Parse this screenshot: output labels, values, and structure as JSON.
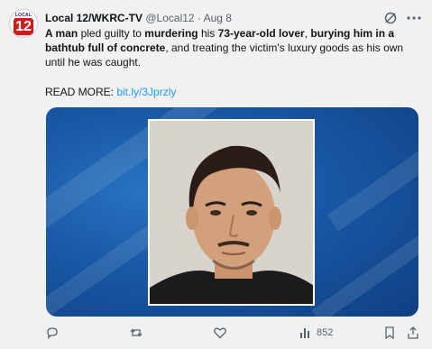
{
  "account": {
    "avatar_text": "LOCAL",
    "avatar_number": "12",
    "name": "Local 12/WKRC-TV",
    "handle": "@Local12",
    "separator": "·",
    "date": "Aug 8"
  },
  "tweet": {
    "segments": [
      {
        "text": "A man",
        "bold": true
      },
      {
        "text": " pled guilty to ",
        "bold": false
      },
      {
        "text": "murdering",
        "bold": true
      },
      {
        "text": " his ",
        "bold": false
      },
      {
        "text": "73-year-old lover",
        "bold": true
      },
      {
        "text": ", ",
        "bold": false
      },
      {
        "text": "burying him in a bathtub full of concrete",
        "bold": true
      },
      {
        "text": ", and treating the victim's luxury goods as his own until he was caught.",
        "bold": false
      }
    ],
    "read_more_label": "READ MORE: ",
    "read_more_link": "bit.ly/3Jprzly"
  },
  "actions": {
    "views_count": "852"
  },
  "icons": {
    "grok": "grok-icon",
    "more": "more-icon",
    "reply": "reply-icon",
    "retweet": "retweet-icon",
    "like": "like-icon",
    "views": "views-icon",
    "bookmark": "bookmark-icon",
    "share": "share-icon"
  },
  "colors": {
    "link": "#1d9bf0",
    "muted": "#536471",
    "text": "#0f1419",
    "media_blue": "#1a5aa8"
  }
}
